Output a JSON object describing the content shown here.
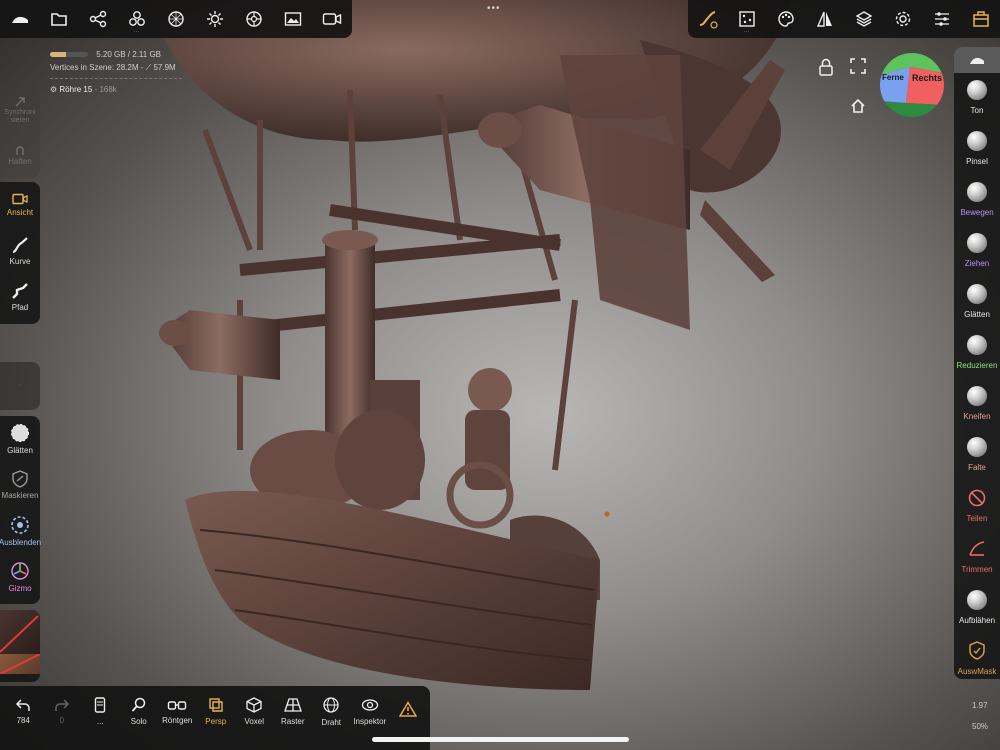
{
  "top_dots": "•••",
  "top_left_tools": [
    {
      "name": "menu-icon"
    },
    {
      "name": "folder-icon"
    },
    {
      "name": "scene-tree-icon"
    },
    {
      "name": "multi-sphere-icon"
    },
    {
      "name": "topology-icon"
    },
    {
      "name": "light-icon"
    },
    {
      "name": "material-icon"
    },
    {
      "name": "image-icon"
    },
    {
      "name": "camera-icon"
    }
  ],
  "top_right_tools": [
    {
      "name": "stroke-icon"
    },
    {
      "name": "painting-icon"
    },
    {
      "name": "palette-icon"
    },
    {
      "name": "symmetry-icon"
    },
    {
      "name": "layers-icon"
    },
    {
      "name": "settings-icon"
    },
    {
      "name": "sliders-icon"
    },
    {
      "name": "toolbox-icon"
    }
  ],
  "stats": {
    "memory": "5.20 GB / 2.11 GB",
    "memory_fraction": 0.42,
    "vertices_label": "Vertices in Szene:",
    "vertices_value": "28.2M",
    "faces_value": "57.9M",
    "object_name": "Röhre 15",
    "object_verts": "168k"
  },
  "left_sync": {
    "sync": "Synchroni sieren",
    "haften": "Haften"
  },
  "left_view": [
    {
      "name": "view-button",
      "label": "Ansicht",
      "color": "#e8b44a"
    },
    {
      "name": "curve-button",
      "label": "Kurve",
      "color": "#e8e8e8"
    },
    {
      "name": "path-button",
      "label": "Pfad",
      "color": "#e8e8e8"
    }
  ],
  "left_masks": [
    {
      "name": "smooth-button",
      "label": "Glätten",
      "color": "#e8e8e8"
    },
    {
      "name": "mask-button",
      "label": "Maskieren",
      "color": "#a8a8a8"
    },
    {
      "name": "hide-button",
      "label": "Ausblenden",
      "color": "#9fc2f0"
    },
    {
      "name": "gizmo-button",
      "label": "Gizmo",
      "color": "#e58be0"
    }
  ],
  "right_tools": [
    {
      "name": "tool-clay",
      "label": "Ton",
      "color": "#e8e8e8"
    },
    {
      "name": "tool-brush",
      "label": "Pinsel",
      "color": "#e8e8e8"
    },
    {
      "name": "tool-move",
      "label": "Bewegen",
      "color": "#b296f2"
    },
    {
      "name": "tool-drag",
      "label": "Ziehen",
      "color": "#b296f2"
    },
    {
      "name": "tool-smooth",
      "label": "Glätten",
      "color": "#e8e8e8"
    },
    {
      "name": "tool-decimate",
      "label": "Reduzieren",
      "color": "#8ee07a"
    },
    {
      "name": "tool-pinch",
      "label": "Kneifen",
      "color": "#e8a08c"
    },
    {
      "name": "tool-crease",
      "label": "Falte",
      "color": "#e8a08c"
    },
    {
      "name": "tool-split",
      "label": "Teilen",
      "color": "#f06a6a"
    },
    {
      "name": "tool-trim",
      "label": "Trimmen",
      "color": "#f06a6a"
    },
    {
      "name": "tool-inflate",
      "label": "Aufblähen",
      "color": "#e8e8e8"
    },
    {
      "name": "tool-selmask",
      "label": "AuswMask",
      "color": "#d9a54a"
    }
  ],
  "view_cube": {
    "front": "Ferne",
    "right": "Rechts"
  },
  "bottom_tools": [
    {
      "name": "undo-button",
      "label": "784"
    },
    {
      "name": "redo-button",
      "label": "0"
    },
    {
      "name": "more-button",
      "label": "..."
    },
    {
      "name": "solo-button",
      "label": "Solo"
    },
    {
      "name": "xray-button",
      "label": "Röntgen"
    },
    {
      "name": "persp-button",
      "label": "Persp"
    },
    {
      "name": "voxel-button",
      "label": "Voxel"
    },
    {
      "name": "grid-button",
      "label": "Raster"
    },
    {
      "name": "wireframe-button",
      "label": "Draht"
    },
    {
      "name": "inspector-button",
      "label": "Inspektor"
    },
    {
      "name": "warning-button",
      "label": ""
    }
  ],
  "bottom_right": {
    "version": "1.97",
    "zoom": "50%"
  }
}
